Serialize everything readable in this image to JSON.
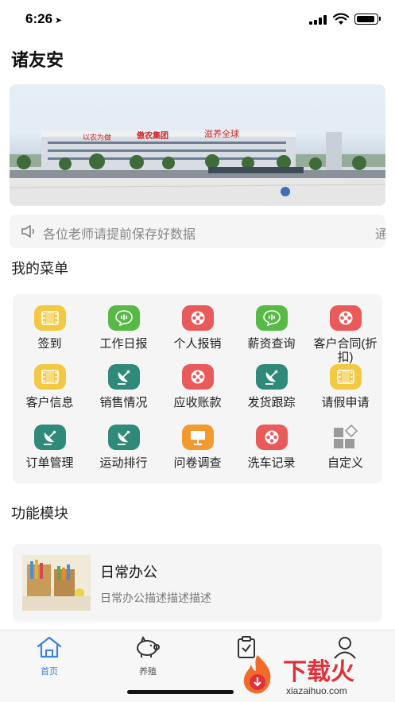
{
  "status_bar": {
    "time": "6:26",
    "location_arrow": "➤"
  },
  "page": {
    "title": "诸友安"
  },
  "banner": {
    "sign_left": "以农为做",
    "sign_center": "傲农集团",
    "sign_right": "滋养全球"
  },
  "notice": {
    "text": "各位老师请提前保存好数据",
    "text_next": "通知"
  },
  "menu": {
    "title": "我的菜单",
    "items": [
      {
        "label": "签到",
        "icon": "film-icon",
        "color": "#f3c944"
      },
      {
        "label": "工作日报",
        "icon": "chat-bubble-icon",
        "color": "#58b947"
      },
      {
        "label": "个人报销",
        "icon": "reel-icon",
        "color": "#e95a5a"
      },
      {
        "label": "薪资查询",
        "icon": "chat-bubble-icon",
        "color": "#58b947"
      },
      {
        "label": "客户合同(折扣)",
        "icon": "reel-icon",
        "color": "#e95a5a"
      },
      {
        "label": "客户信息",
        "icon": "film-icon",
        "color": "#f3c944"
      },
      {
        "label": "销售情况",
        "icon": "satellite-dish-icon",
        "color": "#2f8a7a"
      },
      {
        "label": "应收账款",
        "icon": "reel-icon",
        "color": "#e95a5a"
      },
      {
        "label": "发货跟踪",
        "icon": "satellite-dish-icon",
        "color": "#2f8a7a"
      },
      {
        "label": "请假申请",
        "icon": "film-icon",
        "color": "#f3c944"
      },
      {
        "label": "订单管理",
        "icon": "satellite-dish-icon",
        "color": "#2f8a7a"
      },
      {
        "label": "运动排行",
        "icon": "satellite-dish-icon",
        "color": "#2f8a7a"
      },
      {
        "label": "问卷调查",
        "icon": "presentation-icon",
        "color": "#f29a2e"
      },
      {
        "label": "洗车记录",
        "icon": "reel-icon",
        "color": "#e95a5a"
      },
      {
        "label": "自定义",
        "icon": "custom-grid-icon",
        "color": "#9a9a9a"
      }
    ]
  },
  "modules": {
    "title": "功能模块",
    "card": {
      "title": "日常办公",
      "description": "日常办公描述描述描述"
    }
  },
  "tabbar": {
    "items": [
      {
        "label": "首页",
        "icon": "home-icon",
        "active": true
      },
      {
        "label": "养殖",
        "icon": "piggy-icon",
        "active": false
      },
      {
        "label": "",
        "icon": "clipboard-icon",
        "active": false
      },
      {
        "label": "",
        "icon": "user-icon",
        "active": false
      }
    ],
    "active_color": "#3b82d6",
    "inactive_color": "#555555"
  },
  "watermark": {
    "text": "下载火",
    "sub": "xiazaihuo.com"
  }
}
